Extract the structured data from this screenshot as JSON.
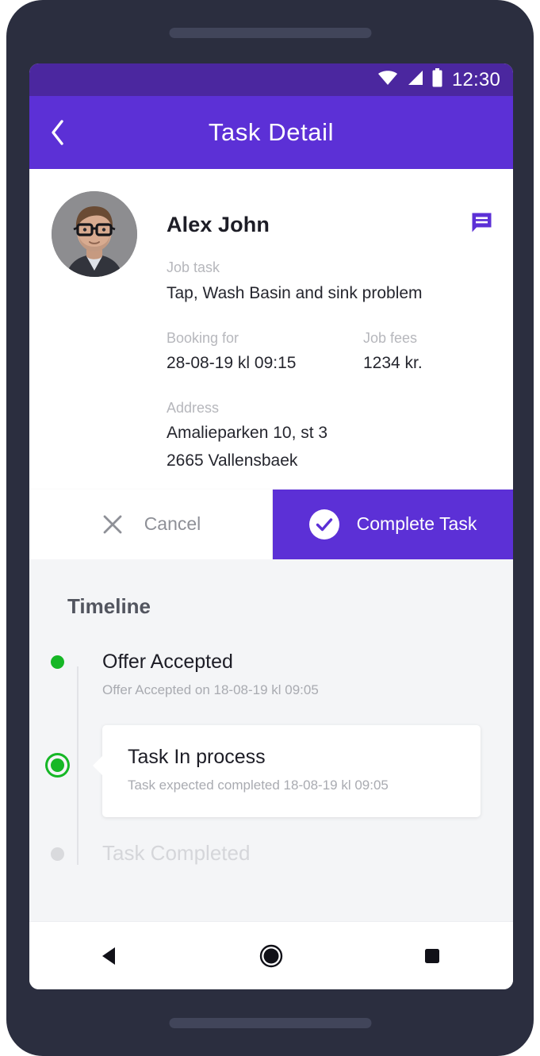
{
  "status_bar": {
    "time": "12:30",
    "icons": [
      "wifi-icon",
      "cellular-signal-icon",
      "battery-icon"
    ]
  },
  "app_bar": {
    "title": "Task Detail",
    "back_icon": "chevron-left-icon"
  },
  "detail": {
    "person_name": "Alex John",
    "message_icon": "message-icon",
    "job_task_label": "Job task",
    "job_task_value": "Tap, Wash Basin and sink problem",
    "booking_label": "Booking for",
    "booking_value": "28-08-19 kl 09:15",
    "fees_label": "Job fees",
    "fees_value": "1234 kr.",
    "address_label": "Address",
    "address_line1": "Amalieparken 10, st 3",
    "address_line2": "2665 Vallensbaek"
  },
  "actions": {
    "cancel_label": "Cancel",
    "cancel_icon": "close-x-icon",
    "complete_label": "Complete Task",
    "complete_icon": "check-circle-icon"
  },
  "timeline": {
    "heading": "Timeline",
    "items": [
      {
        "title": "Offer Accepted",
        "subtitle": "Offer Accepted on 18-08-19 kl 09:05",
        "state": "done"
      },
      {
        "title": "Task In process",
        "subtitle": "Task expected completed  18-08-19 kl 09:05",
        "state": "current"
      },
      {
        "title": "Task Completed",
        "subtitle": "",
        "state": "pending"
      }
    ]
  },
  "android_nav": {
    "back_icon": "nav-back-triangle-icon",
    "home_icon": "nav-home-circle-icon",
    "recents_icon": "nav-recents-square-icon"
  },
  "colors": {
    "status_bar_purple": "#4b279f",
    "app_bar_purple": "#5c30d6",
    "accent_purple": "#5c30d6",
    "timeline_green": "#16b726",
    "pending_gray": "#d9dadd",
    "screen_bg": "#f4f5f7",
    "frame_navy": "#2b2e3f"
  }
}
